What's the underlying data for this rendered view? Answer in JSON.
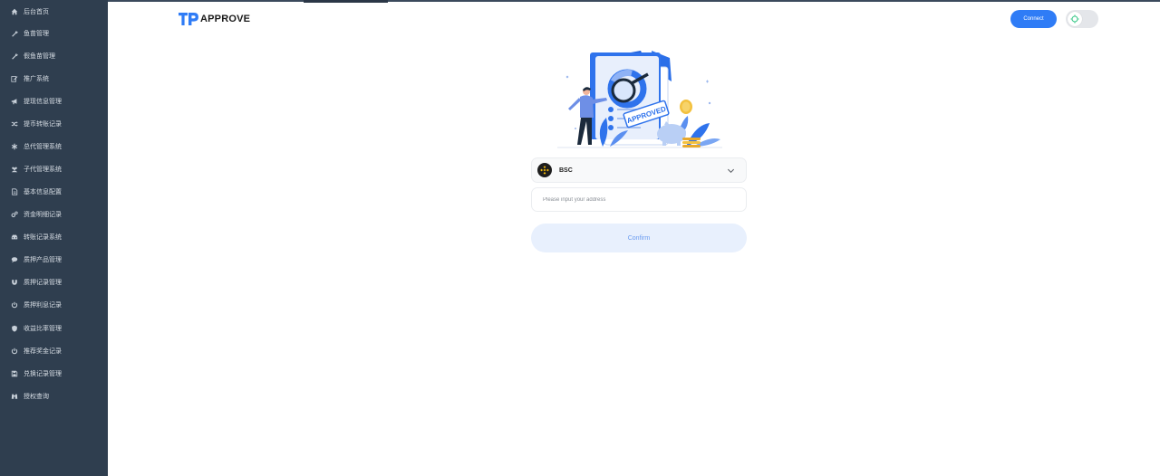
{
  "sidebar": {
    "items": [
      {
        "label": "后台首页",
        "icon": "home-icon"
      },
      {
        "label": "鱼苗管理",
        "icon": "wrench-icon"
      },
      {
        "label": "假鱼苗管理",
        "icon": "wrench-icon"
      },
      {
        "label": "推广系统",
        "icon": "edit-icon"
      },
      {
        "label": "提现信息管理",
        "icon": "megaphone-icon"
      },
      {
        "label": "提币转账记录",
        "icon": "shuffle-icon"
      },
      {
        "label": "总代管理系统",
        "icon": "asterisk-icon"
      },
      {
        "label": "子代管理系统",
        "icon": "users-icon"
      },
      {
        "label": "基本信息配置",
        "icon": "document-icon"
      },
      {
        "label": "资金明细记录",
        "icon": "cogs-icon"
      },
      {
        "label": "转账记录系统",
        "icon": "car-icon"
      },
      {
        "label": "质押产品管理",
        "icon": "comment-icon"
      },
      {
        "label": "质押记录管理",
        "icon": "magnet-icon"
      },
      {
        "label": "质押利息记录",
        "icon": "power-icon"
      },
      {
        "label": "收益比率管理",
        "icon": "shield-icon"
      },
      {
        "label": "推荐奖金记录",
        "icon": "power-icon"
      },
      {
        "label": "兑换记录管理",
        "icon": "save-icon"
      },
      {
        "label": "授权查询",
        "icon": "binoculars-icon"
      }
    ]
  },
  "header": {
    "brand": "APPROVE",
    "connect_label": "Connect",
    "toggle_icon": "crosshair-icon"
  },
  "illustration": {
    "stamp_text": "APPROVED"
  },
  "form": {
    "chain_label": "BSC",
    "chain_icon": "bnb-icon",
    "address_placeholder": "Please input your address",
    "address_value": "",
    "confirm_label": "Confirm"
  },
  "colors": {
    "sidebar_bg": "#2f3e4f",
    "accent": "#2f7cf6",
    "confirm_bg": "#e8f0fd",
    "bnb_yellow": "#f0b90b"
  }
}
